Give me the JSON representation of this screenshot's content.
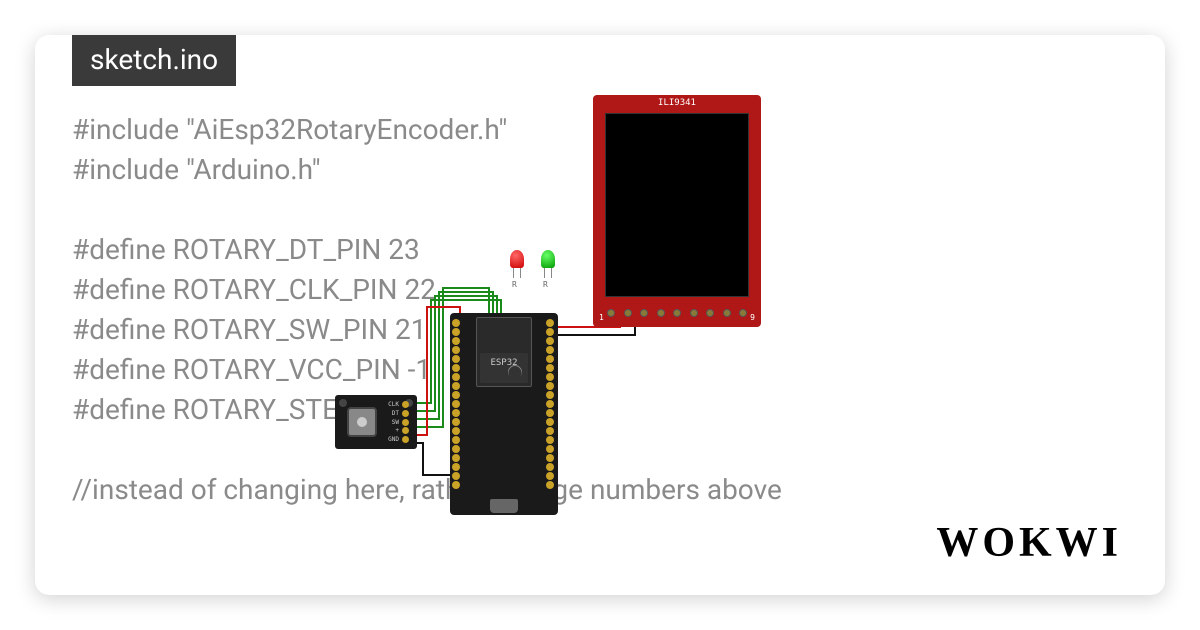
{
  "tab": {
    "filename": "sketch.ino"
  },
  "code": {
    "lines": [
      "#include \"AiEsp32RotaryEncoder.h\"",
      "#include \"Arduino.h\"",
      "",
      "#define ROTARY_DT_PIN 23",
      "#define ROTARY_CLK_PIN 22",
      "#define ROTARY_SW_PIN 21",
      "#define ROTARY_VCC_PIN -1",
      "#define ROTARY_STEP",
      "",
      "//instead of changing here, rather change numbers above"
    ]
  },
  "logo": {
    "text": "WOKWI"
  },
  "lcd": {
    "model": "ILI9341",
    "pin_left_label": "1",
    "pin_right_label": "9",
    "pin_count": 9
  },
  "leds": {
    "red": {
      "label": "R"
    },
    "green": {
      "label": "R"
    }
  },
  "esp32": {
    "label": "ESP32",
    "pins_per_side": 19
  },
  "rotary": {
    "pins": [
      "CLK",
      "DT",
      "SW",
      "+",
      "GND"
    ]
  }
}
